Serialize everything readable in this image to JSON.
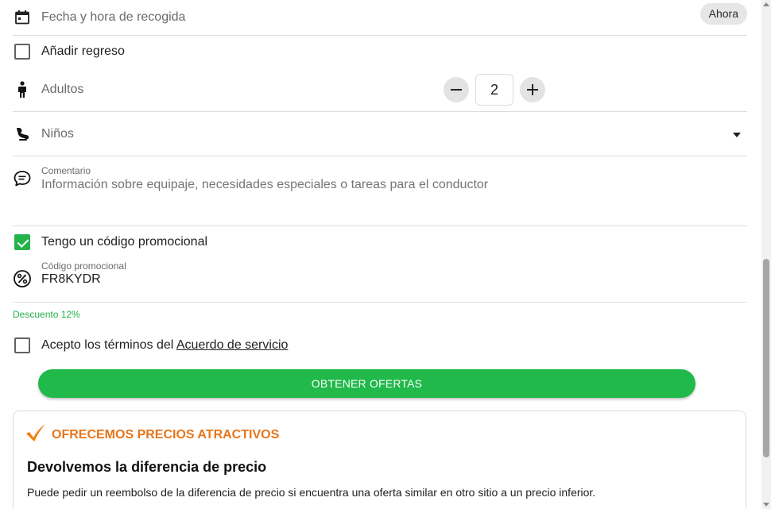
{
  "form": {
    "pickup": {
      "label": "Fecha y hora de recogida",
      "now_button": "Ahora",
      "icon": "calendar-icon"
    },
    "return": {
      "label": "Añadir regreso",
      "checked": false
    },
    "adults": {
      "label": "Adultos",
      "value": "2",
      "icon": "person-icon"
    },
    "children": {
      "label": "Niños",
      "icon": "child-seat-icon"
    },
    "comment": {
      "caption": "Comentario",
      "placeholder": "Información sobre equipaje, necesidades especiales o tareas para el conductor",
      "icon": "chat-bubble-icon"
    },
    "promo_toggle": {
      "label": "Tengo un código promocional",
      "checked": true
    },
    "promo_code": {
      "caption": "Código promocional",
      "value": "FR8KYDR",
      "icon": "percent-icon"
    },
    "discount": "Descuento 12%",
    "terms": {
      "prefix": "Acepto los términos del ",
      "link": "Acuerdo de servicio",
      "checked": false
    },
    "submit": "OBTENER OFERTAS"
  },
  "promo_card": {
    "title": "OFRECEMOS PRECIOS ATRACTIVOS",
    "heading": "Devolvemos la diferencia de precio",
    "text": "Puede pedir un reembolso de la diferencia de precio si encuentra una oferta similar en otro sitio a un precio inferior."
  },
  "colors": {
    "accent_green": "#20b94a",
    "accent_orange": "#e8751a"
  }
}
